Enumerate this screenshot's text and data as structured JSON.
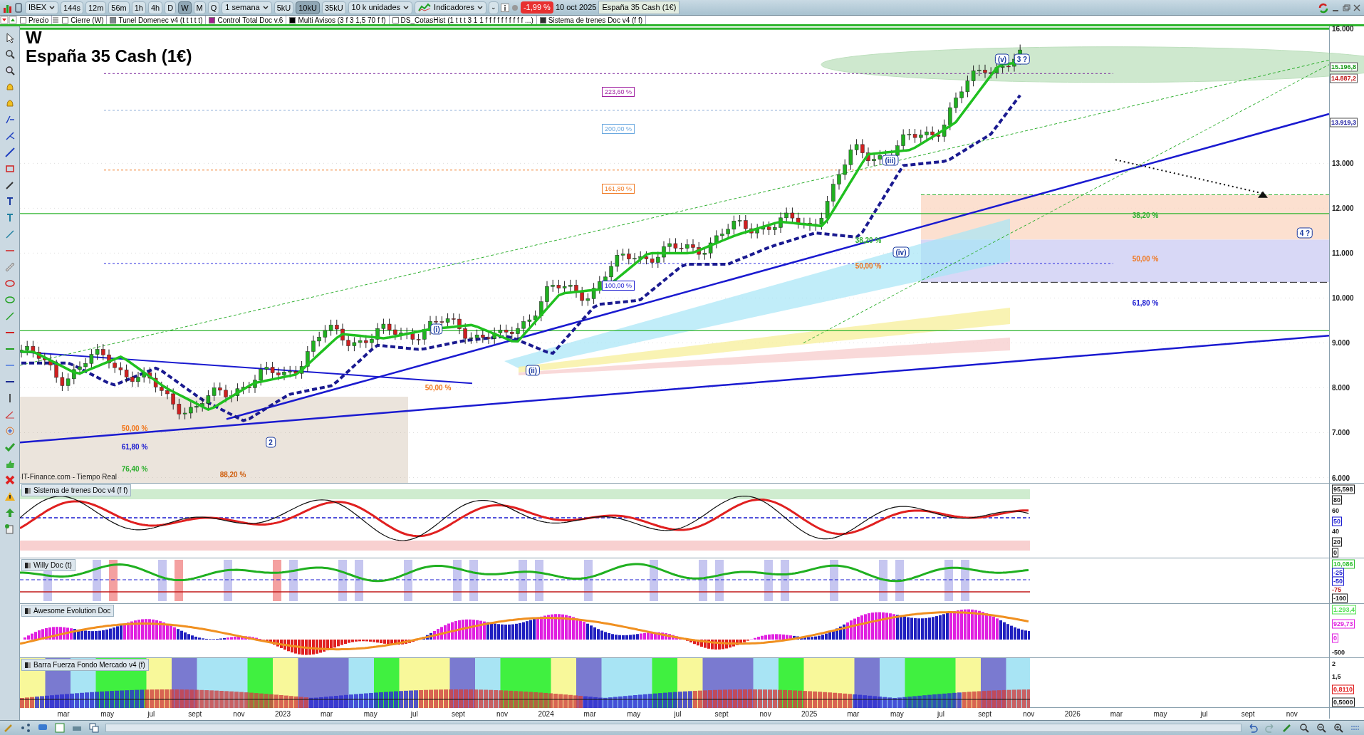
{
  "toolbar": {
    "items": [
      {
        "kind": "dropdown",
        "label": "IBEX",
        "selected": false
      },
      {
        "kind": "button",
        "label": "144s",
        "selected": false
      },
      {
        "kind": "button",
        "label": "12m",
        "selected": false
      },
      {
        "kind": "button",
        "label": "56m",
        "selected": false
      },
      {
        "kind": "button",
        "label": "1h",
        "selected": false
      },
      {
        "kind": "button",
        "label": "4h",
        "selected": false
      },
      {
        "kind": "button",
        "label": "D",
        "selected": false
      },
      {
        "kind": "button",
        "label": "W",
        "selected": true
      },
      {
        "kind": "button",
        "label": "M",
        "selected": false
      },
      {
        "kind": "button",
        "label": "Q",
        "selected": false
      },
      {
        "kind": "dropdown",
        "label": "1 semana",
        "selected": false
      },
      {
        "kind": "button",
        "label": "5kU",
        "selected": false
      },
      {
        "kind": "button",
        "label": "10kU",
        "selected": true
      },
      {
        "kind": "button",
        "label": "35kU",
        "selected": false
      },
      {
        "kind": "dropdown",
        "label": "10 k unidades",
        "selected": false
      },
      {
        "kind": "indicators",
        "label": "Indicadores",
        "selected": false
      },
      {
        "kind": "more",
        "label": "⌄",
        "selected": false
      }
    ],
    "change": "-1,99 %",
    "date": "10 oct 2025",
    "instrument": "España 35 Cash (1€)"
  },
  "indicator_bar": [
    {
      "label": "Precio",
      "color": "#ffffff"
    },
    {
      "label": "Cierre (W)",
      "color": "#ffffff"
    },
    {
      "label": "Tunel Domenec v4 (t t t t t)",
      "color": "#808890"
    },
    {
      "label": "Control Total Doc v.6",
      "color": "#a0208c"
    },
    {
      "label": "Multi Avisos (3 f 3 1,5 70 f f)",
      "color": "#000000"
    },
    {
      "label": "DS_CotasHist (1 t t t 3 1 1 f f f f f f f f f f ...)",
      "color": "#ffffff"
    },
    {
      "label": "Sistema de trenes Doc v4 (f f)",
      "color": "#303030"
    }
  ],
  "main_chart": {
    "period": "W",
    "source": "IT-Finance.com - Tiempo Real",
    "time_axis": [
      "mar",
      "may",
      "jul",
      "sept",
      "nov",
      "2023",
      "mar",
      "may",
      "jul",
      "sept",
      "nov",
      "2024",
      "mar",
      "may",
      "jul",
      "sept",
      "nov",
      "2025",
      "mar",
      "may",
      "jul",
      "sept",
      "nov",
      "2026",
      "mar",
      "may",
      "jul",
      "sept",
      "nov"
    ],
    "price_axis": [
      "16.000",
      "13.000",
      "12.000",
      "11.000",
      "10.000",
      "9.000",
      "8.000",
      "7.000",
      "6.000"
    ],
    "title": "España 35 Cash (1€)",
    "price_tags": [
      {
        "label": "15.196,8",
        "color": "#1a9a1a"
      },
      {
        "label": "14.887,2",
        "color": "#c01818"
      },
      {
        "label": "13.919,3",
        "color": "#1a1aa0"
      }
    ],
    "annotations": [
      {
        "kind": "fib",
        "text": "223,60 %",
        "color": "#a020a0"
      },
      {
        "kind": "fib",
        "text": "200,00 %",
        "color": "#6aa8e0"
      },
      {
        "kind": "fib",
        "text": "161,80 %",
        "color": "#f07820"
      },
      {
        "kind": "fib",
        "text": "100,00 %",
        "color": "#1a1ad0"
      },
      {
        "kind": "level",
        "text": "38,20 %",
        "color": "#30b030"
      },
      {
        "kind": "level",
        "text": "50,00 %",
        "color": "#f07820"
      },
      {
        "kind": "level",
        "text": "61,80 %",
        "color": "#1a1ad0"
      },
      {
        "kind": "level",
        "text": "50,00 %",
        "color": "#f07820"
      },
      {
        "kind": "level",
        "text": "61,80 %",
        "color": "#1a1ad0"
      },
      {
        "kind": "level",
        "text": "76,40 %",
        "color": "#30b030"
      },
      {
        "kind": "level",
        "text": "88,20 %",
        "color": "#d06010"
      },
      {
        "kind": "level",
        "text": "50,00 %",
        "color": "#f07820"
      },
      {
        "kind": "level",
        "text": "38,20 %",
        "color": "#30b030"
      },
      {
        "kind": "level",
        "text": "50,00 %",
        "color": "#f07820"
      },
      {
        "kind": "wave",
        "text": "(v)",
        "color": "#1a3aa0"
      },
      {
        "kind": "wave",
        "text": "3 ?",
        "color": "#1a3aa0"
      },
      {
        "kind": "wave",
        "text": "(iii)",
        "color": "#1a3aa0"
      },
      {
        "kind": "wave",
        "text": "(iv)",
        "color": "#1a3aa0"
      },
      {
        "kind": "wave",
        "text": "(i)",
        "color": "#1a3aa0"
      },
      {
        "kind": "wave",
        "text": "(ii)",
        "color": "#1a3aa0"
      },
      {
        "kind": "wave",
        "text": "2",
        "color": "#1a3aa0"
      },
      {
        "kind": "wave",
        "text": "4 ?",
        "color": "#1a3aa0"
      }
    ]
  },
  "panels": [
    {
      "kind": "trains",
      "title": "Sistema de trenes Doc v4 (f f)",
      "axis": [
        {
          "label": "95,598",
          "color": "#202020",
          "boxed": true
        },
        {
          "label": "80",
          "color": "#202020",
          "boxed": true
        },
        {
          "label": "60",
          "color": "#202020",
          "boxed": false
        },
        {
          "label": "50",
          "color": "#1a1ad0",
          "boxed": true
        },
        {
          "label": "40",
          "color": "#202020",
          "boxed": false
        },
        {
          "label": "20",
          "color": "#202020",
          "boxed": true
        },
        {
          "label": "0",
          "color": "#202020",
          "boxed": true
        }
      ]
    },
    {
      "kind": "willy",
      "title": "Willy Doc (t)",
      "axis": [
        {
          "label": "10,086",
          "color": "#30c030",
          "boxed": true
        },
        {
          "label": "-25",
          "color": "#1a1ad0",
          "boxed": true
        },
        {
          "label": "-50",
          "color": "#1a1ad0",
          "boxed": true
        },
        {
          "label": "-75",
          "color": "#c01818",
          "boxed": false
        },
        {
          "label": "-100",
          "color": "#202020",
          "boxed": true
        }
      ]
    },
    {
      "kind": "awesome",
      "title": "Awesome Evolution Doc",
      "axis": [
        {
          "label": "1.293,4",
          "color": "#50e050",
          "boxed": true
        },
        {
          "label": "929,73",
          "color": "#e020e0",
          "boxed": true
        },
        {
          "label": "0",
          "color": "#e020e0",
          "boxed": true
        },
        {
          "label": "-500",
          "color": "#202020",
          "boxed": false
        }
      ]
    },
    {
      "kind": "strength",
      "title": "Barra Fuerza Fondo Mercado v4 (f)",
      "axis": [
        {
          "label": "2",
          "color": "#202020",
          "boxed": false
        },
        {
          "label": "1,5",
          "color": "#202020",
          "boxed": false
        },
        {
          "label": "0,8110",
          "color": "#e01818",
          "boxed": true
        },
        {
          "label": "0,5000",
          "color": "#202020",
          "boxed": true
        }
      ]
    }
  ]
}
